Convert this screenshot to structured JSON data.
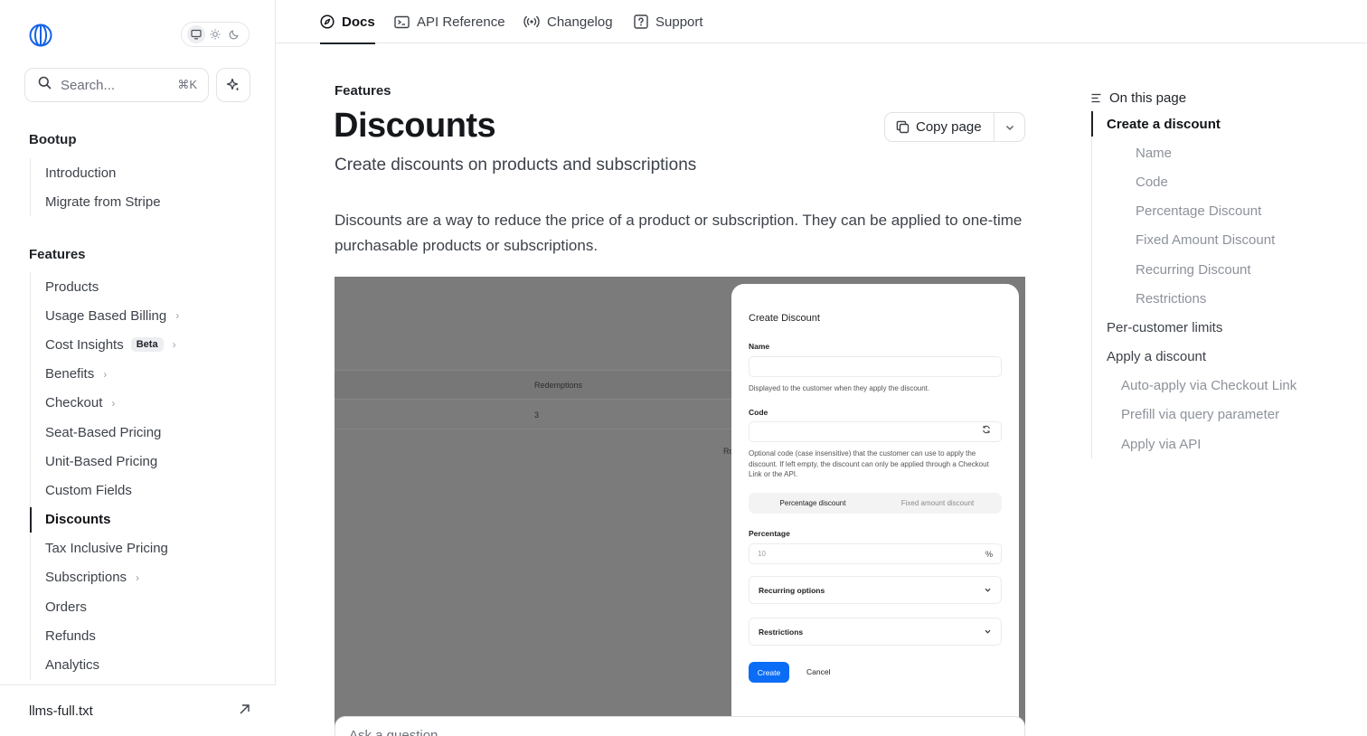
{
  "sidebar": {
    "search_placeholder": "Search...",
    "search_shortcut": "⌘K",
    "groups": [
      {
        "title": "Bootup",
        "items": [
          {
            "label": "Introduction"
          },
          {
            "label": "Migrate from Stripe"
          }
        ]
      },
      {
        "title": "Features",
        "items": [
          {
            "label": "Products"
          },
          {
            "label": "Usage Based Billing",
            "chevron": true
          },
          {
            "label": "Cost Insights",
            "badge": "Beta",
            "chevron": true
          },
          {
            "label": "Benefits",
            "chevron": true
          },
          {
            "label": "Checkout",
            "chevron": true
          },
          {
            "label": "Seat-Based Pricing"
          },
          {
            "label": "Unit-Based Pricing"
          },
          {
            "label": "Custom Fields"
          },
          {
            "label": "Discounts",
            "active": true
          },
          {
            "label": "Tax Inclusive Pricing"
          },
          {
            "label": "Subscriptions",
            "chevron": true
          },
          {
            "label": "Orders"
          },
          {
            "label": "Refunds"
          },
          {
            "label": "Analytics"
          }
        ]
      }
    ],
    "footer_link": "llms-full.txt"
  },
  "topnav": [
    {
      "label": "Docs",
      "icon": "compass-icon",
      "active": true
    },
    {
      "label": "API Reference",
      "icon": "terminal-icon"
    },
    {
      "label": "Changelog",
      "icon": "broadcast-icon"
    },
    {
      "label": "Support",
      "icon": "help-icon"
    }
  ],
  "page": {
    "eyebrow": "Features",
    "title": "Discounts",
    "subtitle": "Create discounts on products and subscriptions",
    "copy_label": "Copy page",
    "lead": "Discounts are a way to reduce the price of a product or subscription. They can be applied to one-time purchasable products or subscriptions.",
    "ask_placeholder": "Ask a question..."
  },
  "figure": {
    "bg_header": "Redemptions",
    "bg_value": "3",
    "bg_fragment": "Ro",
    "modal": {
      "title": "Create Discount",
      "name_label": "Name",
      "name_help": "Displayed to the customer when they apply the discount.",
      "code_label": "Code",
      "code_help": "Optional code (case insensitive) that the customer can use to apply the discount. If left empty, the discount can only be applied through a Checkout Link or the API.",
      "seg_on": "Percentage discount",
      "seg_off": "Fixed amount discount",
      "pct_label": "Percentage",
      "pct_placeholder": "10",
      "pct_symbol": "%",
      "recurring": "Recurring options",
      "restrictions": "Restrictions",
      "create": "Create",
      "cancel": "Cancel"
    }
  },
  "toc": {
    "title": "On this page",
    "items": [
      {
        "label": "Create a discount",
        "level": "l1",
        "active": true
      },
      {
        "label": "Name",
        "level": "l2"
      },
      {
        "label": "Code",
        "level": "l2"
      },
      {
        "label": "Percentage Discount",
        "level": "l2"
      },
      {
        "label": "Fixed Amount Discount",
        "level": "l2"
      },
      {
        "label": "Recurring Discount",
        "level": "l2"
      },
      {
        "label": "Restrictions",
        "level": "l2"
      },
      {
        "label": "Per-customer limits",
        "level": "l1"
      },
      {
        "label": "Apply a discount",
        "level": "l1"
      },
      {
        "label": "Auto-apply via Checkout Link",
        "level": "l2b"
      },
      {
        "label": "Prefill via query parameter",
        "level": "l2b"
      },
      {
        "label": "Apply via API",
        "level": "l2b"
      }
    ]
  }
}
